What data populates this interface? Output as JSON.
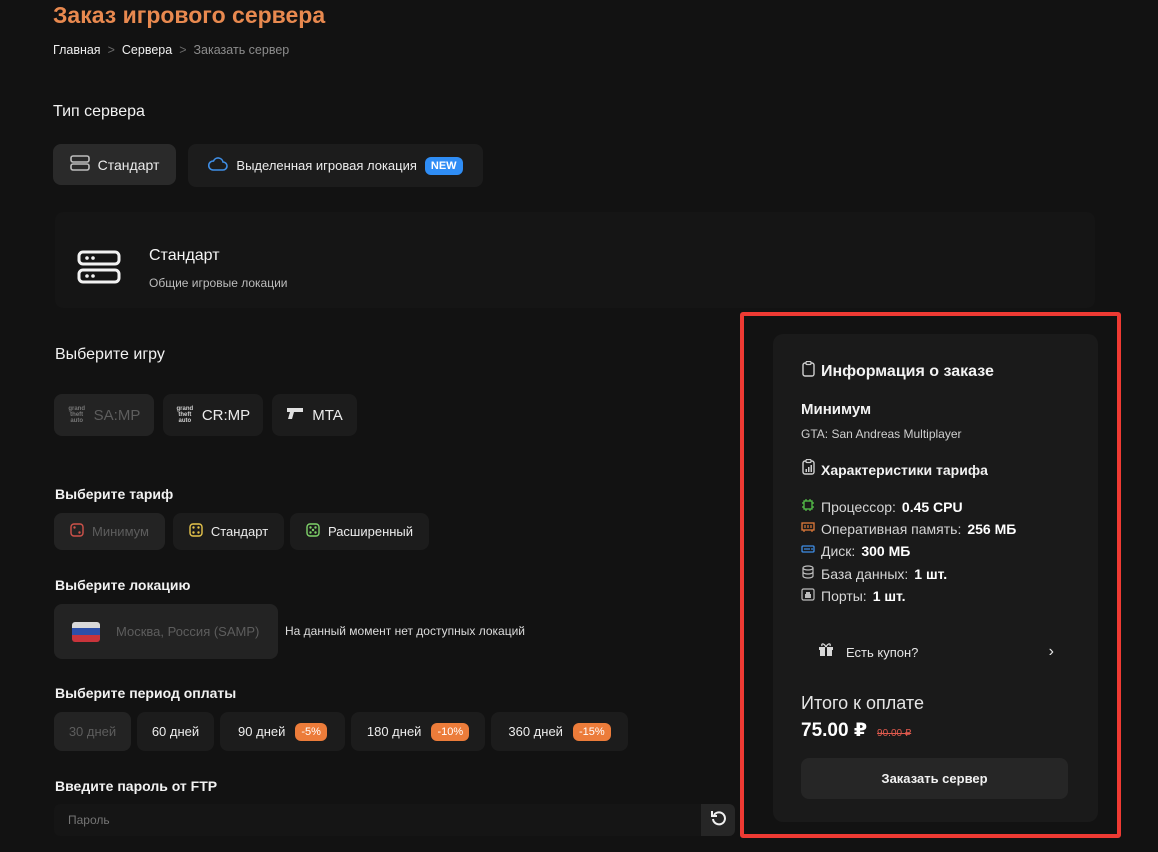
{
  "page": {
    "title": "Заказ игрового сервера"
  },
  "breadcrumb": [
    "Главная",
    "Сервера",
    "Заказать сервер"
  ],
  "breadcrumb_sep": ">",
  "server_type": {
    "title": "Тип сервера",
    "options": [
      {
        "label": "Стандарт",
        "icon": "server-icon",
        "selected": true
      },
      {
        "label": "Выделенная игровая локация",
        "icon": "cloud-icon",
        "badge": "NEW"
      }
    ],
    "card": {
      "title": "Стандарт",
      "subtitle": "Общие игровые локации",
      "icon": "server-stack-icon"
    }
  },
  "game": {
    "title": "Выберите игру",
    "options": [
      {
        "label": "SA:MP",
        "icon": "gta-sa-logo-icon",
        "disabled": true
      },
      {
        "label": "CR:MP",
        "icon": "gta-logo-icon"
      },
      {
        "label": "MTA",
        "icon": "pistol-icon"
      }
    ]
  },
  "tariff": {
    "title": "Выберите тариф",
    "options": [
      {
        "label": "Минимум",
        "icon": "dice-two-icon",
        "color": "#d0534b",
        "disabled": true
      },
      {
        "label": "Стандарт",
        "icon": "dice-four-icon",
        "color": "#e7c54c"
      },
      {
        "label": "Расширенный",
        "icon": "dice-five-icon",
        "color": "#7fd36a"
      }
    ]
  },
  "location": {
    "title": "Выберите локацию",
    "option": {
      "label": "Москва, Россия (SAMP)",
      "icon": "russia-flag-icon",
      "disabled": true
    },
    "notice": "На данный момент нет доступных локаций"
  },
  "period": {
    "title": "Выберите период оплаты",
    "options": [
      {
        "label": "30 дней",
        "disabled": true
      },
      {
        "label": "60 дней"
      },
      {
        "label": "90 дней",
        "discount": "-5%"
      },
      {
        "label": "180 дней",
        "discount": "-10%"
      },
      {
        "label": "360 дней",
        "discount": "-15%"
      }
    ]
  },
  "ftp": {
    "title": "Введите пароль от FTP",
    "placeholder": "Пароль",
    "regenerate_icon": "refresh-icon"
  },
  "order_info": {
    "title": "Информация о заказе",
    "title_icon": "clipboard-icon",
    "tariff_name": "Минимум",
    "game_name": "GTA: San Andreas Multiplayer",
    "specs_title": "Характеристики тарифа",
    "specs_icon": "clipboard-chart-icon",
    "specs": [
      {
        "label": "Процессор:",
        "value": "0.45 CPU",
        "icon": "cpu-icon",
        "color": "#56c24a"
      },
      {
        "label": "Оперативная память:",
        "value": "256 МБ",
        "icon": "ram-icon",
        "color": "#e07a3a"
      },
      {
        "label": "Диск:",
        "value": "300 МБ",
        "icon": "disk-icon",
        "color": "#3f8ee6"
      },
      {
        "label": "База данных:",
        "value": "1 шт.",
        "icon": "database-icon",
        "color": "#bdbdbd"
      },
      {
        "label": "Порты:",
        "value": "1 шт.",
        "icon": "port-icon",
        "color": "#bdbdbd"
      }
    ],
    "coupon": "Есть купон?",
    "total_label": "Итого к оплате",
    "price": "75.00 ₽",
    "old_price": "90.00 ₽",
    "order_button": "Заказать сервер"
  },
  "colors": {
    "accent": "#e8894f",
    "highlight_frame": "#ee3a33",
    "new_badge": "#2f8df5",
    "discount_badge": "#ec7c3a"
  }
}
